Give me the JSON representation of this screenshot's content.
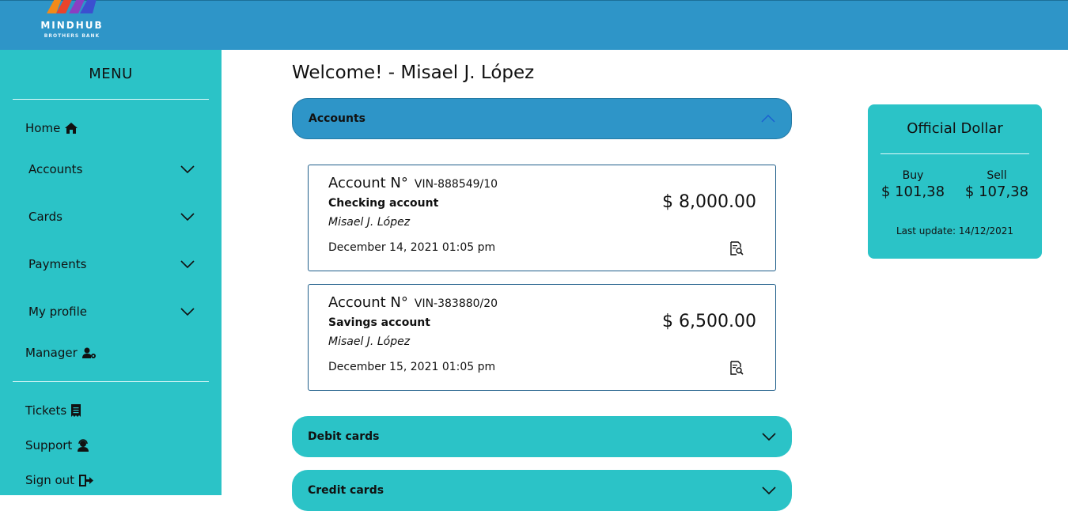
{
  "brand": {
    "name": "MINDHUB",
    "subtitle": "BROTHERS BANK"
  },
  "sidebar": {
    "title": "MENU",
    "items": [
      {
        "label": "Home",
        "icon": "home-icon"
      },
      {
        "label": "Accounts",
        "icon": "chevron-down-icon"
      },
      {
        "label": "Cards",
        "icon": "chevron-down-icon"
      },
      {
        "label": "Payments",
        "icon": "chevron-down-icon"
      },
      {
        "label": "My profile",
        "icon": "chevron-down-icon"
      },
      {
        "label": "Manager",
        "icon": "user-gear-icon"
      },
      {
        "label": "Tickets",
        "icon": "receipt-icon"
      },
      {
        "label": "Support",
        "icon": "headset-icon"
      },
      {
        "label": "Sign out",
        "icon": "sign-out-icon"
      }
    ]
  },
  "main": {
    "welcome": "Welcome! - Misael J. López",
    "sections": [
      {
        "label": "Accounts",
        "state": "expanded"
      },
      {
        "label": "Debit cards",
        "state": "collapsed"
      },
      {
        "label": "Credit cards",
        "state": "collapsed"
      }
    ],
    "accounts": [
      {
        "number_label": "Account N°",
        "number": "VIN-888549/10",
        "type": "Checking account",
        "owner": "Misael J. López",
        "date": "December 14, 2021 01:05 pm",
        "balance": "$ 8,000.00"
      },
      {
        "number_label": "Account N°",
        "number": "VIN-383880/20",
        "type": "Savings account",
        "owner": "Misael J. López",
        "date": "December 15, 2021 01:05 pm",
        "balance": "$ 6,500.00"
      }
    ]
  },
  "dollar": {
    "title": "Official Dollar",
    "buy_label": "Buy",
    "buy_value": "$ 101,38",
    "sell_label": "Sell",
    "sell_value": "$ 107,38",
    "last_update": "Last update: 14/12/2021"
  },
  "colors": {
    "header": "#2e95c8",
    "sidebar": "#2bc3c7",
    "accordion_open": "#2e95c8",
    "accordion_closed": "#2bc3c7",
    "card_border": "#1f5e8a"
  }
}
